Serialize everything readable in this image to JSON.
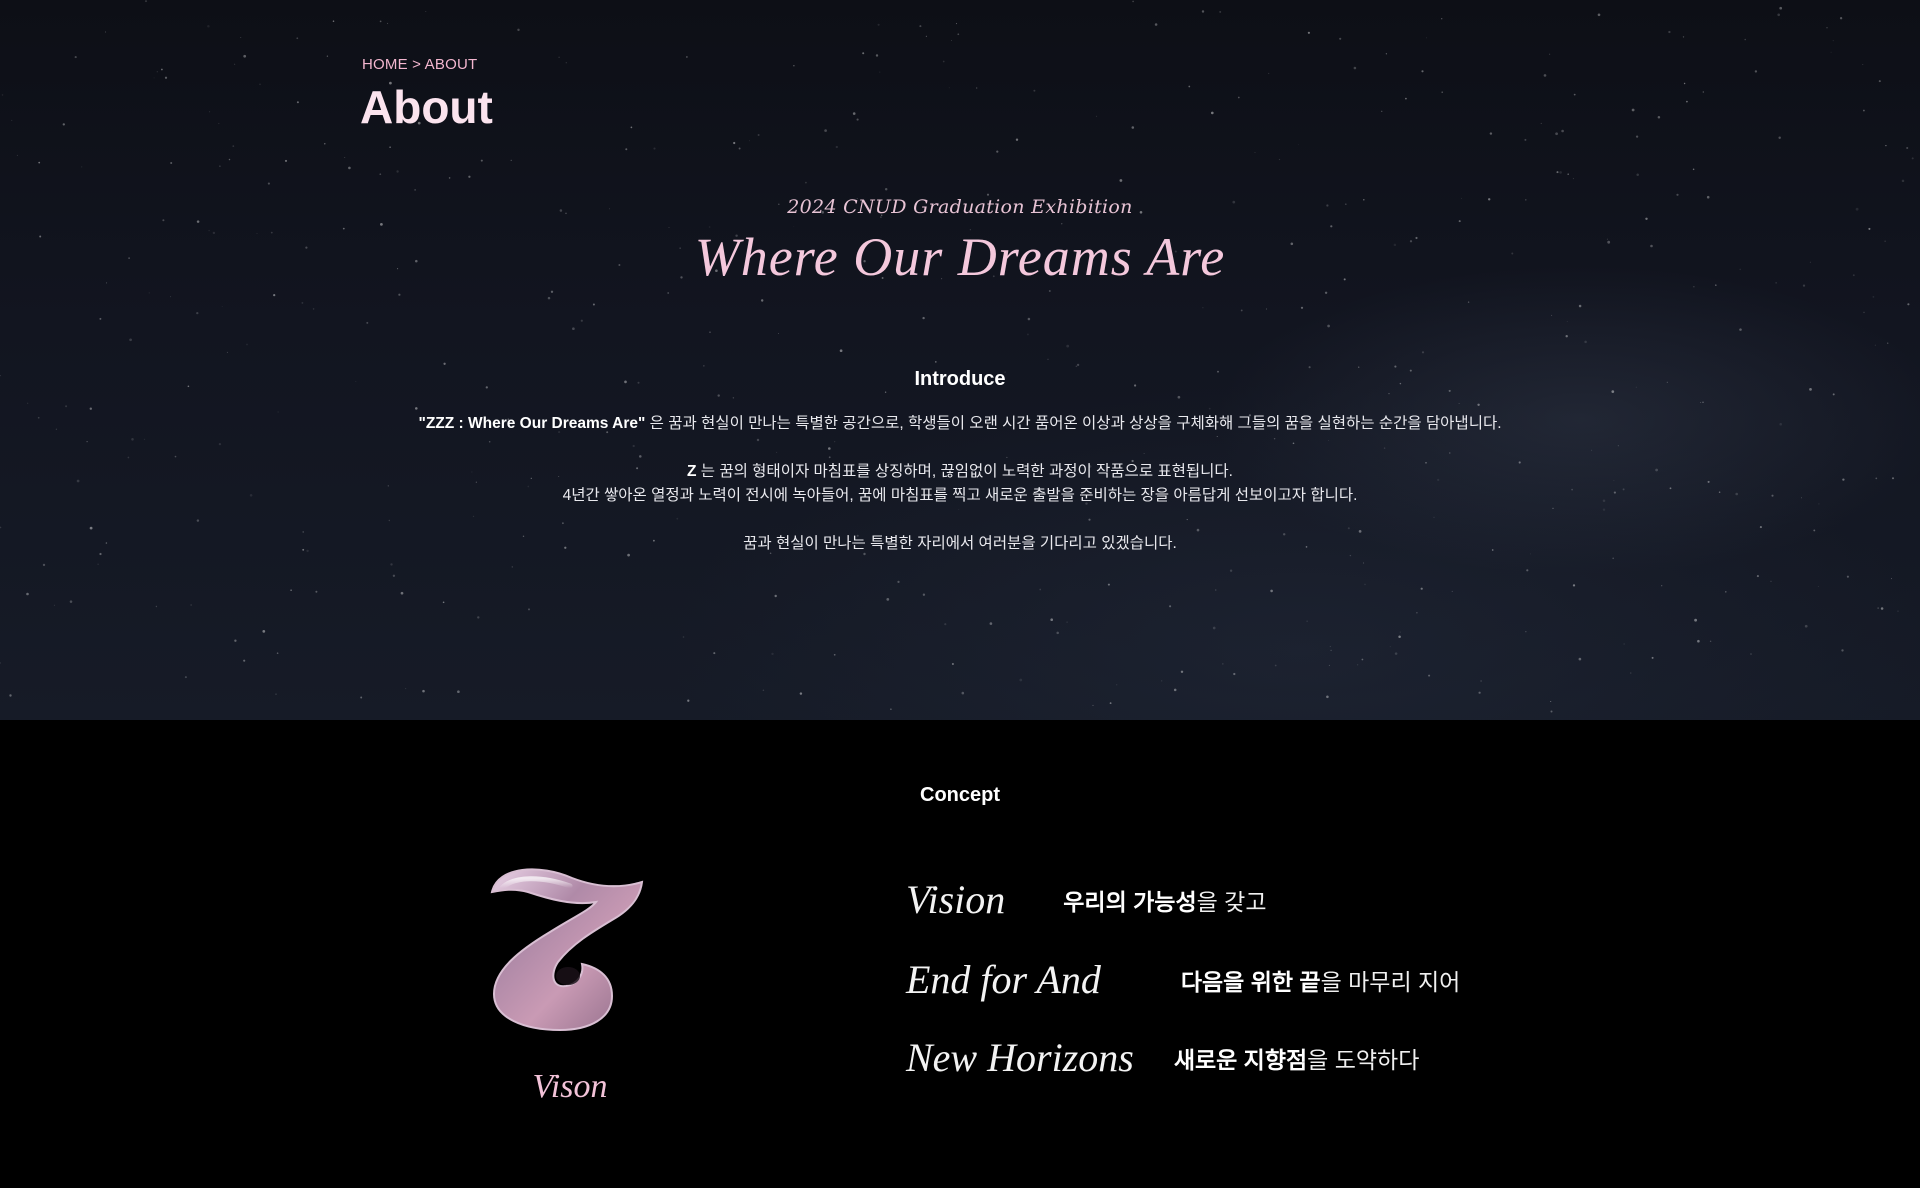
{
  "breadcrumb": "HOME > ABOUT",
  "page_title": "About",
  "exhibition": {
    "subtitle": "2024 CNUD Graduation Exhibition",
    "title": "Where Our Dreams Are"
  },
  "introduce": {
    "heading": "Introduce",
    "line1_bold": "\"ZZZ : Where Our Dreams Are\"",
    "line1_rest": " 은 꿈과 현실이 만나는 특별한 공간으로, 학생들이 오랜 시간 품어온 이상과 상상을 구체화해 그들의 꿈을 실현하는 순간을 담아냅니다.",
    "line2_bold": "Z",
    "line2_rest": " 는 꿈의 형태이자 마침표를 상징하며, 끊임없이 노력한 과정이 작품으로 표현됩니다.",
    "line3": "4년간 쌓아온 열정과 노력이 전시에 녹아들어, 꿈에 마침표를 찍고 새로운 출발을 준비하는 장을 아름답게 선보이고자 합니다.",
    "line4": "꿈과 현실이 만나는 특별한 자리에서 여러분을 기다리고 있겠습니다."
  },
  "concept": {
    "heading": "Concept",
    "logo_caption": "Vison",
    "items": [
      {
        "en": "Vision",
        "ko_bold": "우리의 가능성",
        "ko_rest": "을 갖고"
      },
      {
        "en": "End for And",
        "ko_bold": "다음을 위한 끝",
        "ko_rest": "을 마무리 지어"
      },
      {
        "en": "New Horizons",
        "ko_bold": "새로운 지향점",
        "ko_rest": "을 도약하다"
      }
    ]
  },
  "colors": {
    "accent_pink": "#f4c8dc",
    "breadcrumb_pink": "#f3b6cf",
    "hero_bg": "#121520",
    "concept_bg": "#000000"
  },
  "icons": {
    "logo": "z-logo-icon"
  }
}
